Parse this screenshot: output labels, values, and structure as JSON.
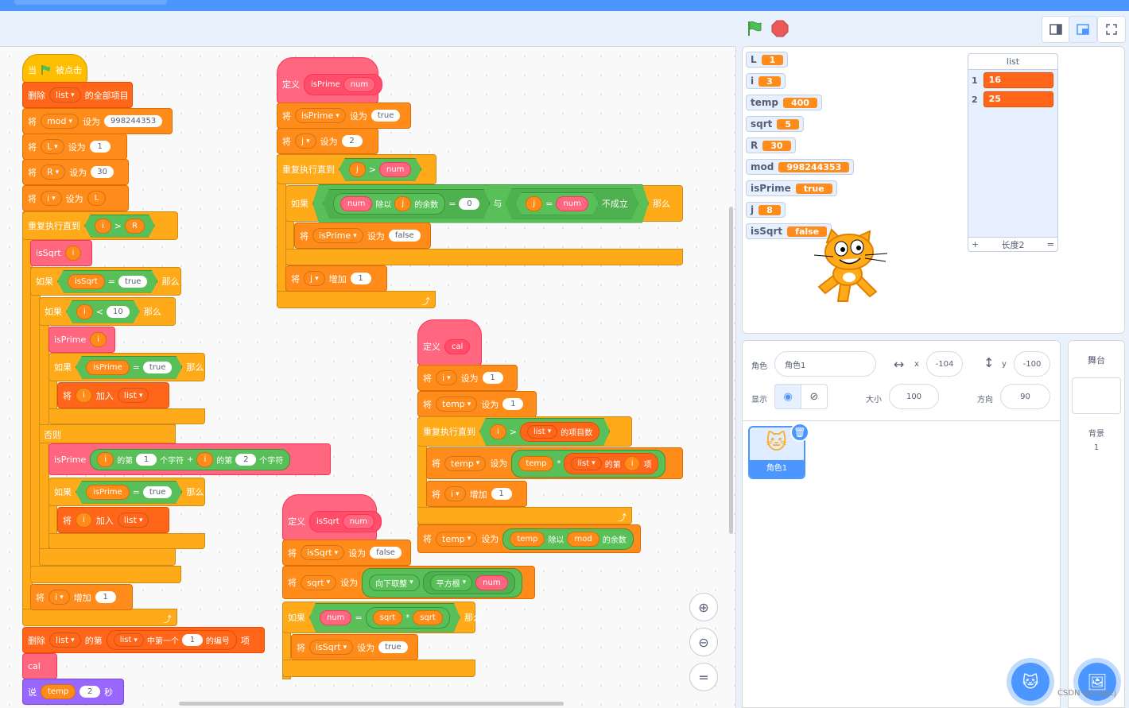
{
  "scripts": {
    "main": {
      "hat": {
        "when": "当",
        "flag_icon": "green-flag-icon",
        "clicked": "被点击"
      },
      "delete_all": {
        "label": "删除",
        "list": "list",
        "suffix": "的全部项目"
      },
      "set_mod": {
        "label": "将",
        "var": "mod",
        "set": "设为",
        "value": "998244353"
      },
      "set_L": {
        "label": "将",
        "var": "L",
        "set": "设为",
        "value": "1"
      },
      "set_R": {
        "label": "将",
        "var": "R",
        "set": "设为",
        "value": "30"
      },
      "set_i": {
        "label": "将",
        "var": "i",
        "set": "设为",
        "value": "L"
      },
      "repeat_until": {
        "label": "重复执行直到",
        "left": "i",
        "op": ">",
        "right": "R"
      },
      "call_issqrt": {
        "proc": "isSqrt",
        "arg": "i"
      },
      "if1": {
        "label": "如果",
        "left": "isSqrt",
        "op": "=",
        "right": "true",
        "then": "那么"
      },
      "if2": {
        "label": "如果",
        "left": "i",
        "op": "<",
        "right": "10",
        "then": "那么"
      },
      "call_isprime1": {
        "proc": "isPrime",
        "arg": "i"
      },
      "if3": {
        "label": "如果",
        "left": "isPrime",
        "op": "=",
        "right": "true",
        "then": "那么"
      },
      "add1": {
        "label": "将",
        "item": "i",
        "add": "加入",
        "list": "list"
      },
      "else": "否则",
      "call_isprime2": {
        "proc": "isPrime",
        "a": "i",
        "of": "的第",
        "n1": "1",
        "char": "个字符",
        "plus": "+",
        "b": "i",
        "of2": "的第",
        "n2": "2",
        "char2": "个字符"
      },
      "if4": {
        "label": "如果",
        "left": "isPrime",
        "op": "=",
        "right": "true",
        "then": "那么"
      },
      "add2": {
        "label": "将",
        "item": "i",
        "add": "加入",
        "list": "list"
      },
      "inc_i": {
        "label": "将",
        "var": "i",
        "inc": "增加",
        "value": "1"
      },
      "delete_item": {
        "label": "删除",
        "list": "list",
        "of": "的第",
        "list2": "list",
        "first": "中第一个",
        "value": "1",
        "index": "的编号",
        "item": "项"
      },
      "cal": "cal",
      "say": {
        "label": "说",
        "var": "temp",
        "value": "2",
        "secs": "秒"
      }
    },
    "def_isprime": {
      "define": "定义",
      "name": "isPrime",
      "param": "num",
      "set_isprime": {
        "label": "将",
        "var": "isPrime",
        "set": "设为",
        "value": "true"
      },
      "set_j": {
        "label": "将",
        "var": "j",
        "set": "设为",
        "value": "2"
      },
      "repeat_until": {
        "label": "重复执行直到",
        "left": "j",
        "op": ">",
        "right": "num"
      },
      "if": {
        "label": "如果",
        "a": "num",
        "mod": "除以",
        "b": "j",
        "rem": "的余数",
        "eq": "=",
        "zero": "0",
        "and": "与",
        "c": "j",
        "eq2": "=",
        "d": "num",
        "not": "不成立",
        "then": "那么"
      },
      "set_false": {
        "label": "将",
        "var": "isPrime",
        "set": "设为",
        "value": "false"
      },
      "inc_j": {
        "label": "将",
        "var": "j",
        "inc": "增加",
        "value": "1"
      }
    },
    "def_cal": {
      "define": "定义",
      "name": "cal",
      "set_i": {
        "label": "将",
        "var": "i",
        "set": "设为",
        "value": "1"
      },
      "set_temp": {
        "label": "将",
        "var": "temp",
        "set": "设为",
        "value": "1"
      },
      "repeat_until": {
        "label": "重复执行直到",
        "left": "i",
        "op": ">",
        "list": "list",
        "len": "的项目数"
      },
      "set_temp2": {
        "label": "将",
        "var": "temp",
        "set": "设为",
        "a": "temp",
        "op": "*",
        "list": "list",
        "of": "的第",
        "b": "i",
        "item": "项"
      },
      "inc_i": {
        "label": "将",
        "var": "i",
        "inc": "增加",
        "value": "1"
      },
      "set_temp3": {
        "label": "将",
        "var": "temp",
        "set": "设为",
        "a": "temp",
        "mod": "除以",
        "b": "mod",
        "rem": "的余数"
      }
    },
    "def_issqrt": {
      "define": "定义",
      "name": "isSqrt",
      "param": "num",
      "set_issqrt": {
        "label": "将",
        "var": "isSqrt",
        "set": "设为",
        "value": "false"
      },
      "set_sqrt": {
        "label": "将",
        "var": "sqrt",
        "set": "设为",
        "floor": "向下取整",
        "sqrtfn": "平方根",
        "arg": "num"
      },
      "if": {
        "label": "如果",
        "a": "num",
        "eq": "=",
        "b": "sqrt",
        "mul": "*",
        "c": "sqrt",
        "then": "那么"
      },
      "set_true": {
        "label": "将",
        "var": "isSqrt",
        "set": "设为",
        "value": "true"
      }
    }
  },
  "monitors": [
    {
      "name": "L",
      "value": "1"
    },
    {
      "name": "i",
      "value": "3"
    },
    {
      "name": "temp",
      "value": "400"
    },
    {
      "name": "sqrt",
      "value": "5"
    },
    {
      "name": "R",
      "value": "30"
    },
    {
      "name": "mod",
      "value": "998244353"
    },
    {
      "name": "isPrime",
      "value": "true"
    },
    {
      "name": "j",
      "value": "8"
    },
    {
      "name": "isSqrt",
      "value": "false"
    }
  ],
  "list_monitor": {
    "title": "list",
    "items": [
      {
        "index": "1",
        "value": "16"
      },
      {
        "index": "2",
        "value": "25"
      }
    ],
    "add": "+",
    "length": "长度2",
    "resize": "="
  },
  "sprite_info": {
    "sprite_label": "角色",
    "sprite_name": "角色1",
    "x_label": "x",
    "x": "-104",
    "y_label": "y",
    "y": "-100",
    "show_label": "显示",
    "size_label": "大小",
    "size": "100",
    "direction_label": "方向",
    "direction": "90"
  },
  "sprite_tile": {
    "name": "角色1"
  },
  "stage_pane": {
    "title": "舞台",
    "backdrops_label": "背景",
    "backdrops_count": "1"
  },
  "watermark": "CSDN @Logecj",
  "colors": {
    "control": "#ffab19",
    "variables": "#ff8c1a",
    "lists": "#ff661a",
    "custom": "#ff6680",
    "operators": "#59c059",
    "looks": "#9966ff",
    "events": "#ffbf00"
  }
}
